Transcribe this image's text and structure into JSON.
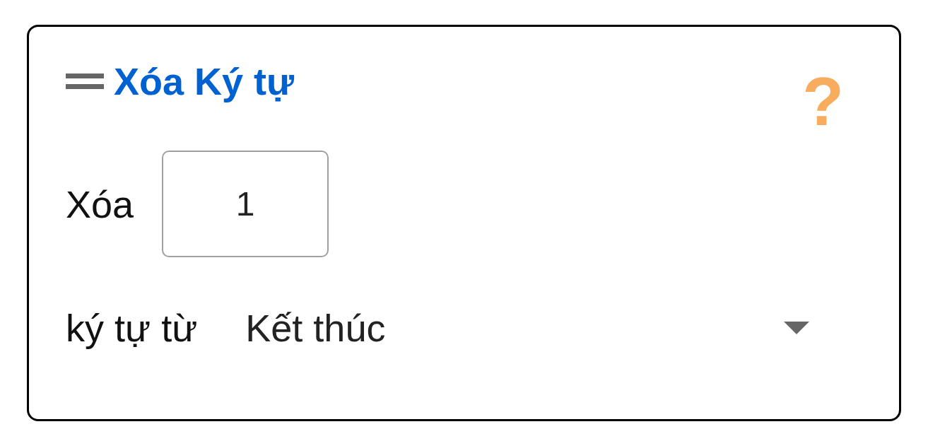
{
  "block": {
    "title": "Xóa Ký tự",
    "help": "?"
  },
  "fields": [
    {
      "kind": "number",
      "label": "Xóa",
      "value": "1"
    },
    {
      "kind": "dropdown",
      "label": "ký tự từ",
      "value": "Kết thúc"
    }
  ]
}
